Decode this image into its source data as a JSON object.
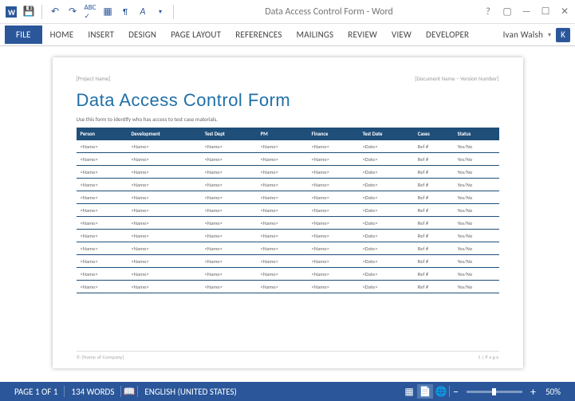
{
  "titlebar": {
    "title": "Data Access Control Form - Word"
  },
  "qat": [
    "word",
    "save",
    "undo",
    "redo",
    "spell",
    "table",
    "style",
    "caret",
    "sep"
  ],
  "ribbon": {
    "tabs": [
      "FILE",
      "HOME",
      "INSERT",
      "DESIGN",
      "PAGE LAYOUT",
      "REFERENCES",
      "MAILINGS",
      "REVIEW",
      "VIEW",
      "DEVELOPER"
    ],
    "user": "Ivan Walsh",
    "badge": "K"
  },
  "document": {
    "header_left": "[Project Name]",
    "header_right": "[Document Name – Version Number]",
    "title": "Data Access Control Form",
    "subtitle": "Use this form to identify who has access to test case materials.",
    "columns": [
      "Person",
      "Development",
      "Test Dept",
      "PM",
      "Finance",
      "Test Date",
      "Cases",
      "Status"
    ],
    "rows": [
      [
        "<Name>",
        "<Name>",
        "<Name>",
        "<Name>",
        "<Name>",
        "<Date>",
        "Ref #",
        "Yes/No"
      ],
      [
        "<Name>",
        "<Name>",
        "<Name>",
        "<Name>",
        "<Name>",
        "<Date>",
        "Ref #",
        "Yes/No"
      ],
      [
        "<Name>",
        "<Name>",
        "<Name>",
        "<Name>",
        "<Name>",
        "<Date>",
        "Ref #",
        "Yes/No"
      ],
      [
        "<Name>",
        "<Name>",
        "<Name>",
        "<Name>",
        "<Name>",
        "<Date>",
        "Ref #",
        "Yes/No"
      ],
      [
        "<Name>",
        "<Name>",
        "<Name>",
        "<Name>",
        "<Name>",
        "<Date>",
        "Ref #",
        "Yes/No"
      ],
      [
        "<Name>",
        "<Name>",
        "<Name>",
        "<Name>",
        "<Name>",
        "<Date>",
        "Ref #",
        "Yes/No"
      ],
      [
        "<Name>",
        "<Name>",
        "<Name>",
        "<Name>",
        "<Name>",
        "<Date>",
        "Ref #",
        "Yes/No"
      ],
      [
        "<Name>",
        "<Name>",
        "<Name>",
        "<Name>",
        "<Name>",
        "<Date>",
        "Ref #",
        "Yes/No"
      ],
      [
        "<Name>",
        "<Name>",
        "<Name>",
        "<Name>",
        "<Name>",
        "<Date>",
        "Ref #",
        "Yes/No"
      ],
      [
        "<Name>",
        "<Name>",
        "<Name>",
        "<Name>",
        "<Name>",
        "<Date>",
        "Ref #",
        "Yes/No"
      ],
      [
        "<Name>",
        "<Name>",
        "<Name>",
        "<Name>",
        "<Name>",
        "<Date>",
        "Ref #",
        "Yes/No"
      ],
      [
        "<Name>",
        "<Name>",
        "<Name>",
        "<Name>",
        "<Name>",
        "<Date>",
        "Ref #",
        "Yes/No"
      ]
    ],
    "footer_left": "© [Name of Company]",
    "footer_right": "1 | P a g e"
  },
  "statusbar": {
    "page": "PAGE 1 OF 1",
    "words": "134 WORDS",
    "lang": "ENGLISH (UNITED STATES)",
    "zoom": "50%"
  }
}
